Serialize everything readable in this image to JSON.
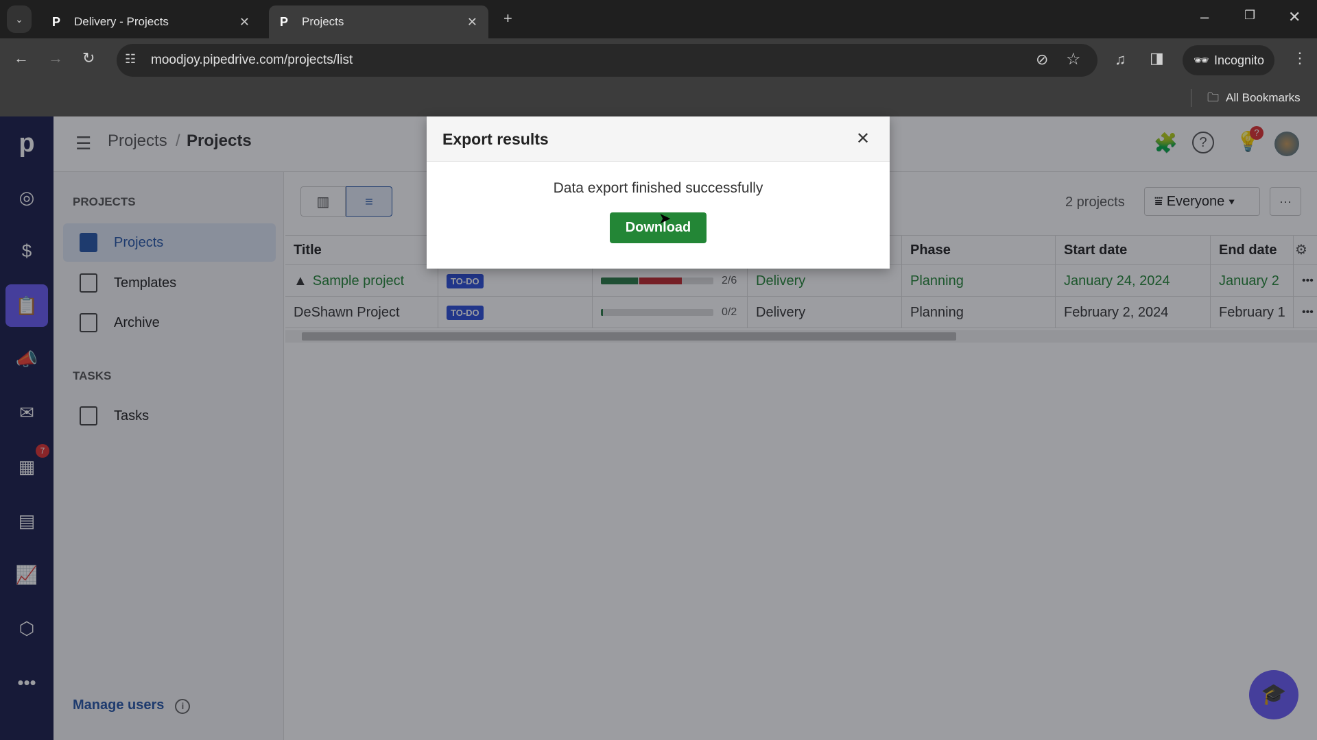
{
  "browser": {
    "tabs": [
      {
        "title": "Delivery - Projects",
        "active": false
      },
      {
        "title": "Projects",
        "active": true
      }
    ],
    "url": "moodjoy.pipedrive.com/projects/list",
    "profile": "Incognito",
    "bookmarks_label": "All Bookmarks"
  },
  "rail": {
    "logo": "p",
    "activity_badge": "7",
    "active_color": "#6a5cf5"
  },
  "header": {
    "breadcrumb_parent": "Projects",
    "breadcrumb_sep": "/",
    "breadcrumb_current": "Projects",
    "bulb_badge": "?"
  },
  "nav": {
    "section_projects": "PROJECTS",
    "items": [
      {
        "label": "Projects"
      },
      {
        "label": "Templates"
      },
      {
        "label": "Archive"
      }
    ],
    "section_tasks": "TASKS",
    "tasks_item": "Tasks",
    "manage_users": "Manage users"
  },
  "toolbar": {
    "count": "2 projects",
    "filter": "Everyone",
    "more": "···"
  },
  "table": {
    "columns": [
      "Title",
      "Phase",
      "Start date",
      "End date"
    ],
    "rows": [
      {
        "title": "Sample project",
        "status": "TO-DO",
        "progress": "2/6",
        "progress_done": 0.33,
        "progress_overdue": 0.38,
        "pipeline": "Delivery",
        "phase": "Planning",
        "start": "January 24, 2024",
        "end": "January 2"
      },
      {
        "title": "DeShawn Project",
        "status": "TO-DO",
        "progress": "0/2",
        "progress_done": 0.02,
        "progress_overdue": 0,
        "pipeline": "Delivery",
        "phase": "Planning",
        "start": "February 2, 2024",
        "end": "February 1"
      }
    ]
  },
  "modal": {
    "title": "Export results",
    "message": "Data export finished successfully",
    "download": "Download",
    "close": "✕"
  }
}
